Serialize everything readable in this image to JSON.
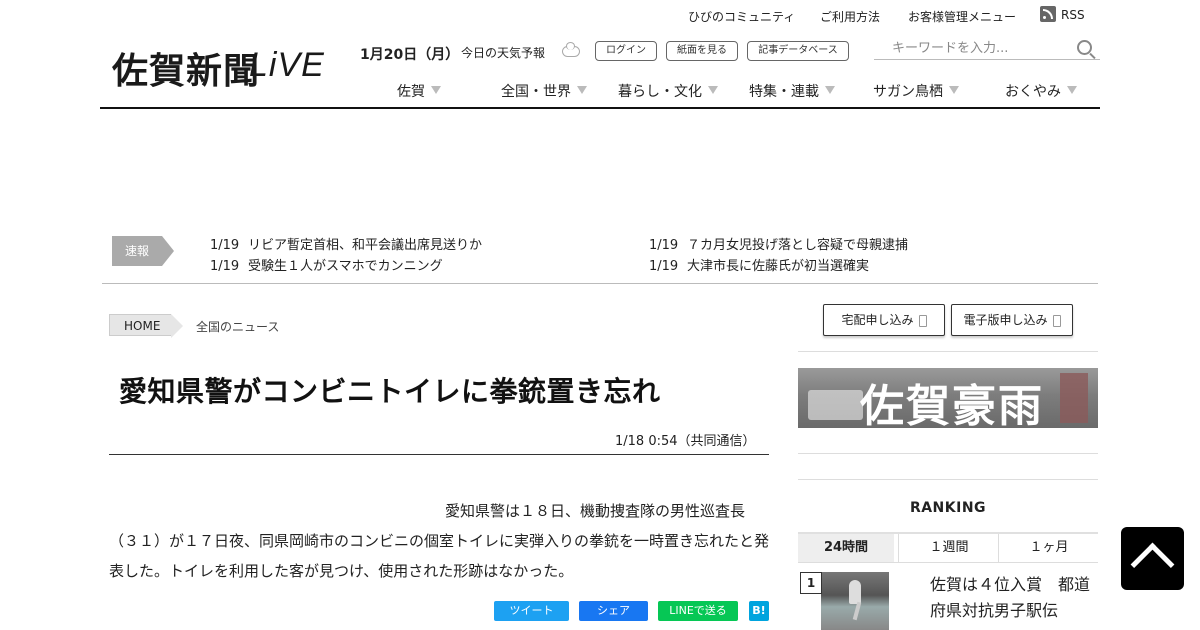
{
  "utility": {
    "community": "ひびのコミュニティ",
    "guide": "ご利用方法",
    "account": "お客様管理メニュー",
    "rss": "RSS"
  },
  "logo": {
    "kanji": "佐賀新聞",
    "live": "LiVE"
  },
  "header": {
    "date": "1月20日（月）",
    "weather": "今日の天気予報",
    "login": "ログイン",
    "paper": "紙面を見る",
    "database": "記事データベース"
  },
  "search": {
    "placeholder": "キーワードを入力..."
  },
  "nav": [
    "佐賀",
    "全国・世界",
    "暮らし・文化",
    "特集・連載",
    "サガン鳥栖",
    "おくやみ"
  ],
  "breaking": {
    "label": "速報",
    "items": [
      {
        "date": "1/19",
        "text": "リビア暫定首相、和平会議出席見送りか"
      },
      {
        "date": "1/19",
        "text": "受験生１人がスマホでカンニング"
      },
      {
        "date": "1/19",
        "text": "７カ月女児投げ落とし容疑で母親逮捕"
      },
      {
        "date": "1/19",
        "text": "大津市長に佐藤氏が初当選確実"
      }
    ]
  },
  "breadcrumb": {
    "home": "HOME",
    "current": "全国のニュース"
  },
  "article": {
    "headline": "愛知県警がコンビニトイレに拳銃置き忘れ",
    "dateline": "1/18 0:54（共同通信）",
    "body": "愛知県警は１８日、機動捜査隊の男性巡査長（３１）が１７日夜、同県岡崎市のコンビニの個室トイレに実弾入りの拳銃を一時置き忘れたと発表した。トイレを利用した客が見つけ、使用された形跡はなかった。"
  },
  "share": {
    "twitter": "ツイート",
    "facebook": "シェア",
    "line": "LINEで送る",
    "hatena": "B!"
  },
  "sidebar": {
    "delivery": "宅配申し込み",
    "digital": "電子版申し込み",
    "banner": "佐賀豪雨",
    "ranking_title": "RANKING",
    "tabs": [
      "24時間",
      "１週間",
      "１ヶ月"
    ],
    "rank1": {
      "num": "1",
      "text": "佐賀は４位入賞　都道府県対抗男子駅伝"
    }
  }
}
